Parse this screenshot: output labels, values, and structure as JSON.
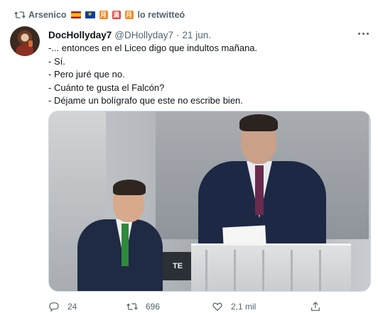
{
  "retweet": {
    "user": "Arsenico",
    "suffix": "lo retwitteó",
    "kanji": [
      "月",
      "満",
      "月"
    ]
  },
  "tweet": {
    "display_name": "DocHollyday7",
    "handle": "@DHollyday7",
    "separator": "·",
    "date": "21 jun.",
    "lines": [
      "-... entonces en el Liceo digo que indultos mañana.",
      "- Sí.",
      "- Pero juré que no.",
      "- Cuánto te gusta el Falcón?",
      "- Déjame un bolígrafo que este no escribe bien."
    ]
  },
  "media": {
    "sign_text": "TE"
  },
  "actions": {
    "reply_count": "24",
    "retweet_count": "696",
    "like_count": "2,1 mil"
  },
  "colors": {
    "text": "#0f1419",
    "secondary": "#536471"
  }
}
